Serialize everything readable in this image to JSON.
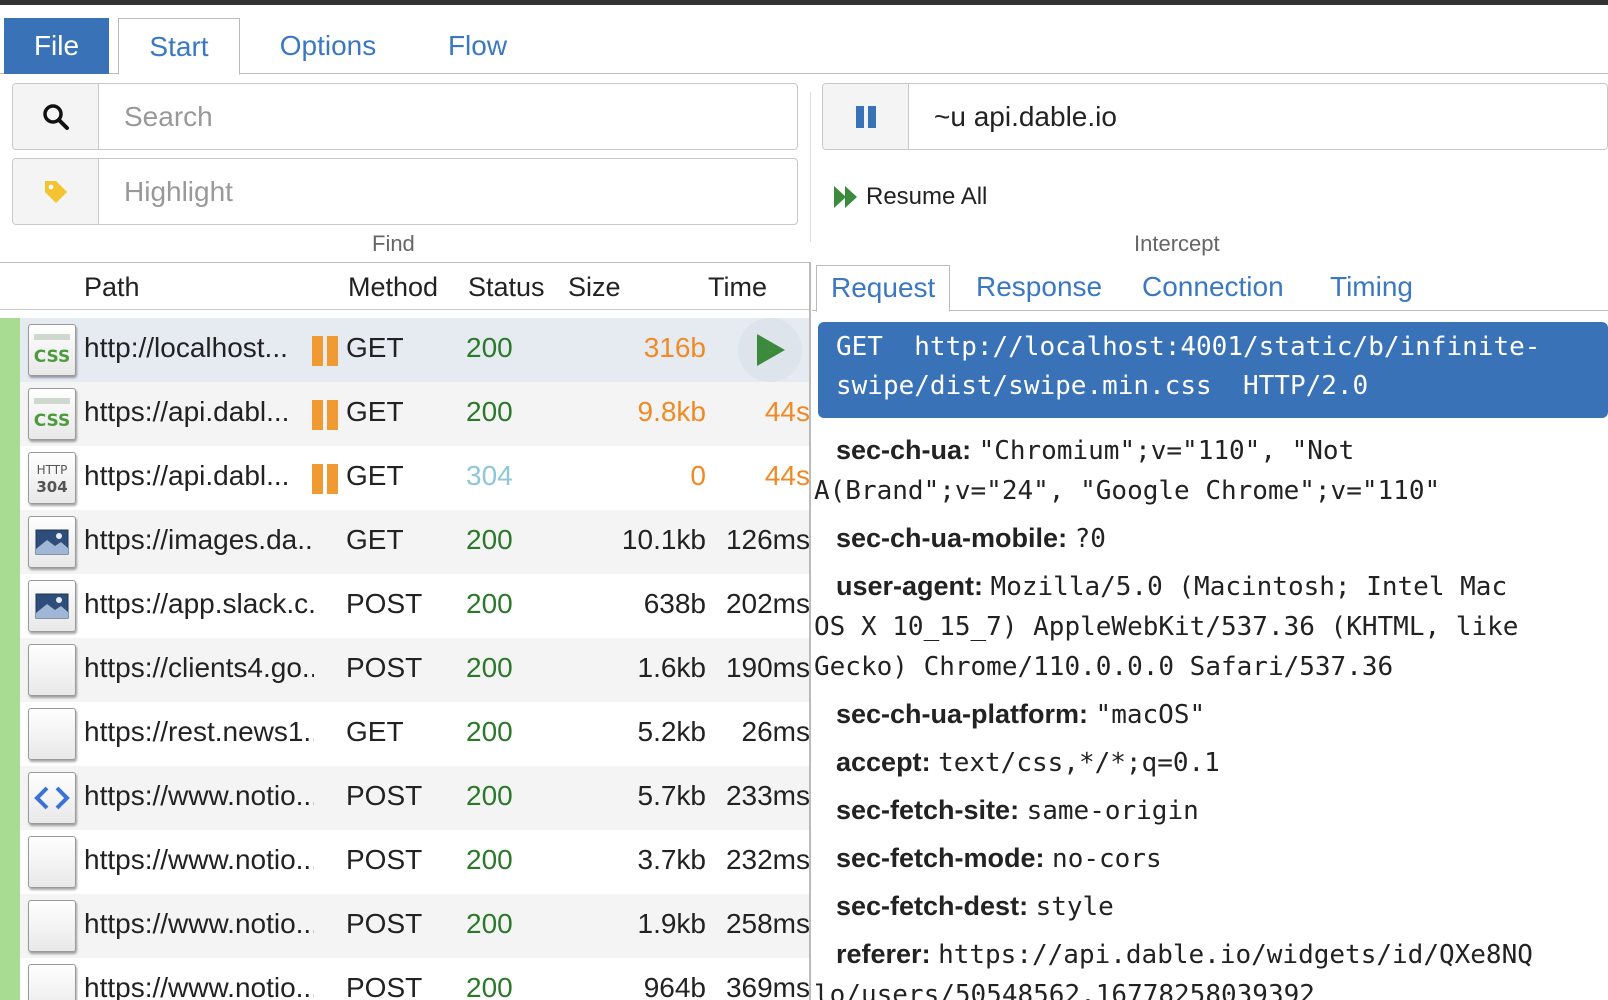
{
  "tabs": {
    "file": "File",
    "start": "Start",
    "options": "Options",
    "flow": "Flow"
  },
  "find": {
    "label": "Find",
    "search_placeholder": "Search",
    "highlight_placeholder": "Highlight"
  },
  "intercept": {
    "label": "Intercept",
    "filter_value": "~u api.dable.io",
    "resume_all": "Resume All"
  },
  "list": {
    "columns": {
      "path": "Path",
      "method": "Method",
      "status": "Status",
      "size": "Size",
      "time": "Time"
    },
    "rows": [
      {
        "path": "http://localhost...",
        "method": "GET",
        "status": "200",
        "size": "316b",
        "time": "",
        "icon": "css-icon"
      },
      {
        "path": "https://api.dabl...",
        "method": "GET",
        "status": "200",
        "size": "9.8kb",
        "time": "44s",
        "icon": "css-icon"
      },
      {
        "path": "https://api.dabl...",
        "method": "GET",
        "status": "304",
        "size": "0",
        "time": "44s",
        "icon": "http-304-icon"
      },
      {
        "path": "https://images.da...",
        "method": "GET",
        "status": "200",
        "size": "10.1kb",
        "time": "126ms",
        "icon": "image-icon"
      },
      {
        "path": "https://app.slack.c...",
        "method": "POST",
        "status": "200",
        "size": "638b",
        "time": "202ms",
        "icon": "image-icon"
      },
      {
        "path": "https://clients4.go...",
        "method": "POST",
        "status": "200",
        "size": "1.6kb",
        "time": "190ms",
        "icon": "document-icon"
      },
      {
        "path": "https://rest.news1....",
        "method": "GET",
        "status": "200",
        "size": "5.2kb",
        "time": "26ms",
        "icon": "document-icon"
      },
      {
        "path": "https://www.notio...",
        "method": "POST",
        "status": "200",
        "size": "5.7kb",
        "time": "233ms",
        "icon": "code-icon"
      },
      {
        "path": "https://www.notio...",
        "method": "POST",
        "status": "200",
        "size": "3.7kb",
        "time": "232ms",
        "icon": "document-icon"
      },
      {
        "path": "https://www.notio...",
        "method": "POST",
        "status": "200",
        "size": "1.9kb",
        "time": "258ms",
        "icon": "document-icon"
      },
      {
        "path": "https://www.notio...",
        "method": "POST",
        "status": "200",
        "size": "964b",
        "time": "369ms",
        "icon": "document-icon"
      }
    ]
  },
  "detail": {
    "tabs": {
      "request": "Request",
      "response": "Response",
      "connection": "Connection",
      "timing": "Timing"
    },
    "request_line_1": "GET  http://localhost:4001/static/b/infinite-",
    "request_line_2": "swipe/dist/swipe.min.css  HTTP/2.0",
    "headers": [
      {
        "key": "sec-ch-ua",
        "value": "\"Chromium\";v=\"110\", \"Not",
        "value2": "A(Brand\";v=\"24\", \"Google Chrome\";v=\"110\""
      },
      {
        "key": "sec-ch-ua-mobile",
        "value": "?0"
      },
      {
        "key": "user-agent",
        "value": "Mozilla/5.0 (Macintosh; Intel Mac",
        "value2": "OS X 10_15_7) AppleWebKit/537.36 (KHTML, like",
        "value3": "Gecko) Chrome/110.0.0.0 Safari/537.36"
      },
      {
        "key": "sec-ch-ua-platform",
        "value": "\"macOS\""
      },
      {
        "key": "accept",
        "value": "text/css,*/*;q=0.1"
      },
      {
        "key": "sec-fetch-site",
        "value": "same-origin"
      },
      {
        "key": "sec-fetch-mode",
        "value": "no-cors"
      },
      {
        "key": "sec-fetch-dest",
        "value": "style"
      },
      {
        "key": "referer",
        "value": "https://api.dable.io/widgets/id/QXe8NQ",
        "value2": "lo/users/50548562.16778258039392"
      }
    ]
  },
  "colors": {
    "accent": "#3a72b8",
    "link": "#3a78c4",
    "status_ok": "#2a7a2a",
    "paused": "#f09a34",
    "row_bar": "#a8dc92"
  }
}
